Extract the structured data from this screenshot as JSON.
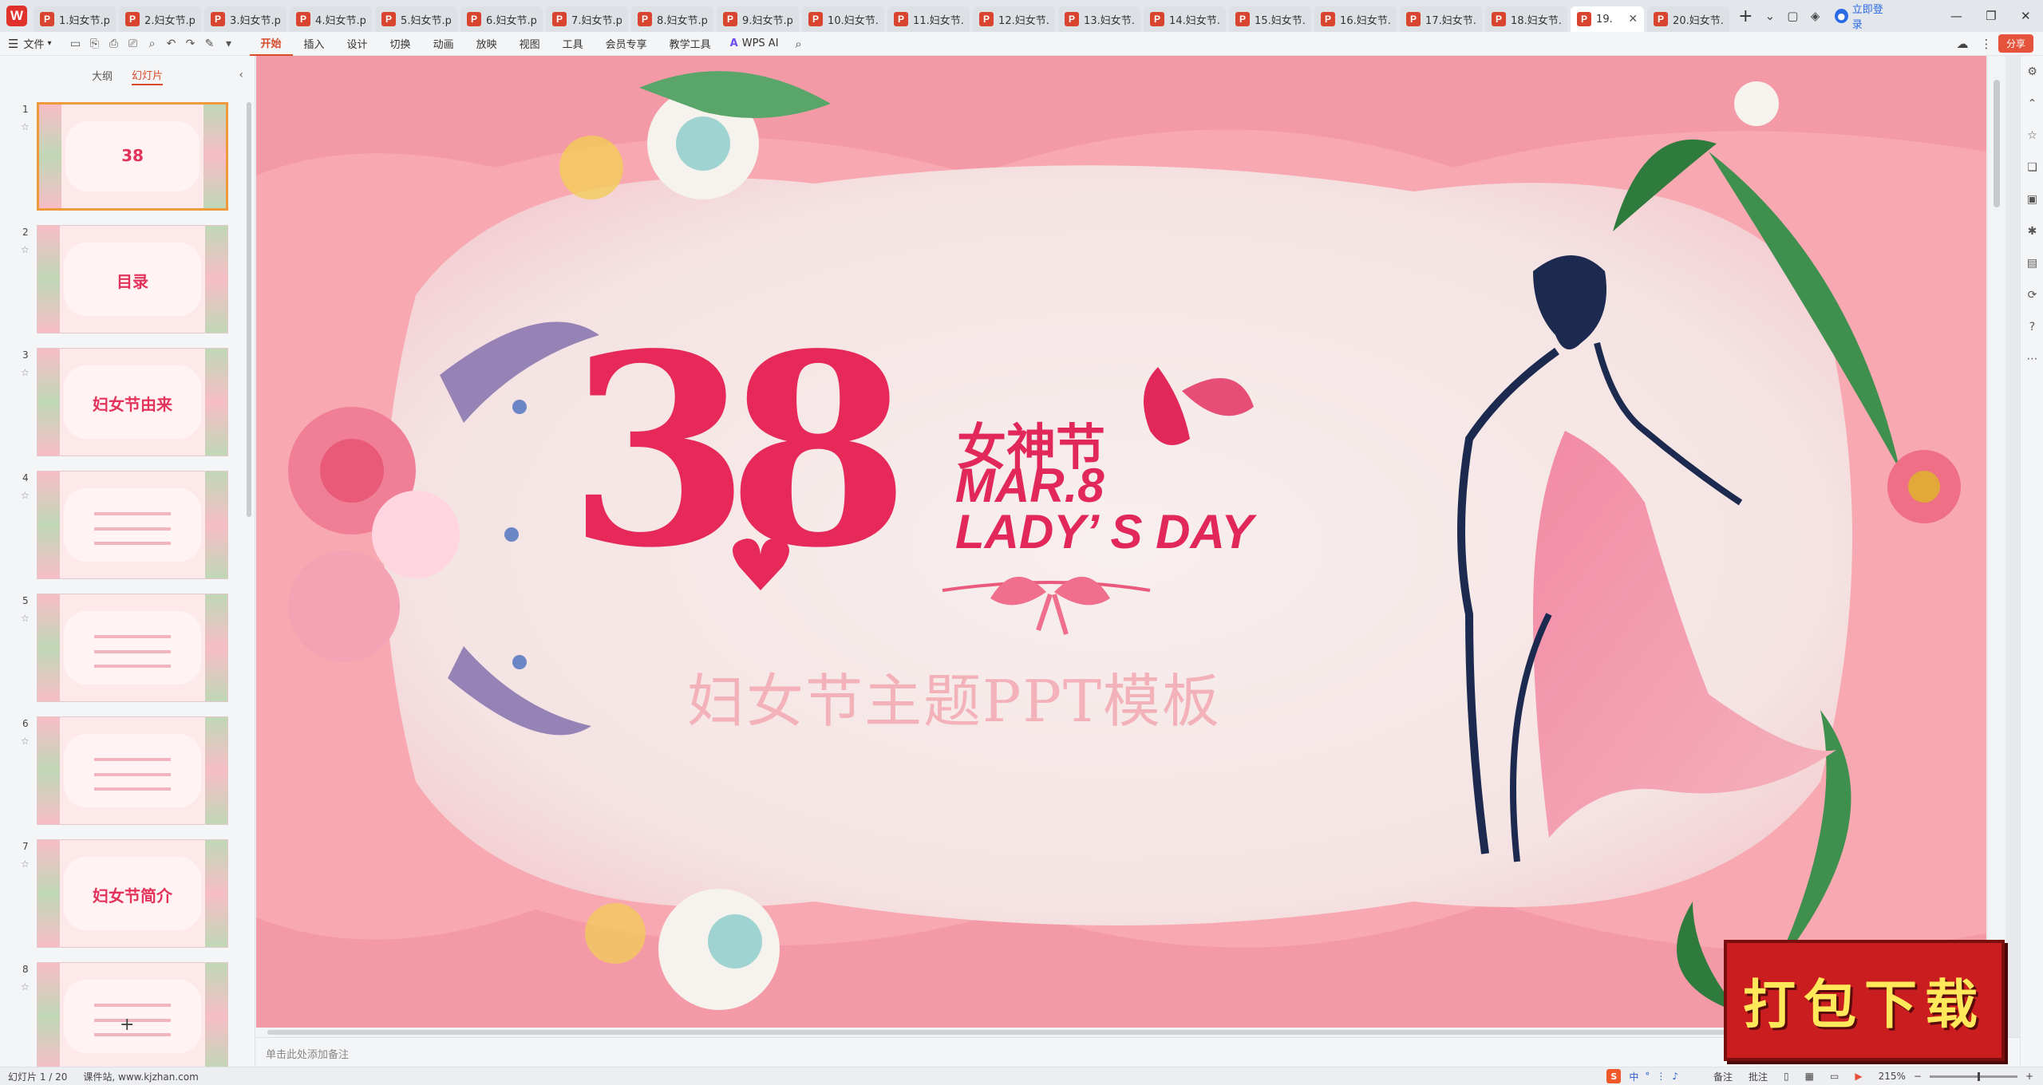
{
  "app": {
    "logo": "W",
    "tabs": [
      {
        "label": "1.妇女节.p"
      },
      {
        "label": "2.妇女节.p"
      },
      {
        "label": "3.妇女节.p"
      },
      {
        "label": "4.妇女节.p"
      },
      {
        "label": "5.妇女节.p"
      },
      {
        "label": "6.妇女节.p"
      },
      {
        "label": "7.妇女节.p"
      },
      {
        "label": "8.妇女节.p"
      },
      {
        "label": "9.妇女节.p"
      },
      {
        "label": "10.妇女节.p"
      },
      {
        "label": "11.妇女节.p"
      },
      {
        "label": "12.妇女节.p"
      },
      {
        "label": "13.妇女节.p"
      },
      {
        "label": "14.妇女节.p"
      },
      {
        "label": "15.妇女节.p"
      },
      {
        "label": "16.妇女节.p"
      },
      {
        "label": "17.妇女节.p"
      },
      {
        "label": "18.妇女节.p"
      },
      {
        "label": "19.",
        "active": true
      },
      {
        "label": "20.妇女节.p"
      }
    ],
    "login_label": "立即登录"
  },
  "menu": {
    "file_label": "文件",
    "items": [
      "开始",
      "插入",
      "设计",
      "切换",
      "动画",
      "放映",
      "视图",
      "工具",
      "会员专享",
      "教学工具"
    ],
    "wps_ai_label": "WPS AI",
    "share_label": "分享"
  },
  "left_panel": {
    "tab_outline": "大纲",
    "tab_slides": "幻灯片",
    "thumbs": [
      {
        "num": "1",
        "text": "38",
        "selected": true
      },
      {
        "num": "2",
        "text": "目录"
      },
      {
        "num": "3",
        "text": "妇女节由来"
      },
      {
        "num": "4",
        "text": ""
      },
      {
        "num": "5",
        "text": ""
      },
      {
        "num": "6",
        "text": ""
      },
      {
        "num": "7",
        "text": "妇女节简介"
      },
      {
        "num": "8",
        "text": ""
      }
    ],
    "add_label": "+"
  },
  "slide": {
    "number_text": "38",
    "goddess_text": "女神节",
    "mar_text": "MAR.8",
    "lady_text": "LADY’ S DAY",
    "subtitle": "妇女节主题PPT模板",
    "colors": {
      "accent": "#e2275a",
      "bg": "#f7a9b1",
      "center": "#f6eaea"
    }
  },
  "notes": {
    "placeholder": "单击此处添加备注"
  },
  "status": {
    "slide_count": "幻灯片 1 / 20",
    "source": "课件站, www.kjzhan.com",
    "ime_chars": [
      "中",
      "°",
      "⋮",
      "♪"
    ],
    "notes_label": "备注",
    "comment_label": "批注",
    "zoom": "215%"
  },
  "badge": {
    "text": "打包下载"
  }
}
